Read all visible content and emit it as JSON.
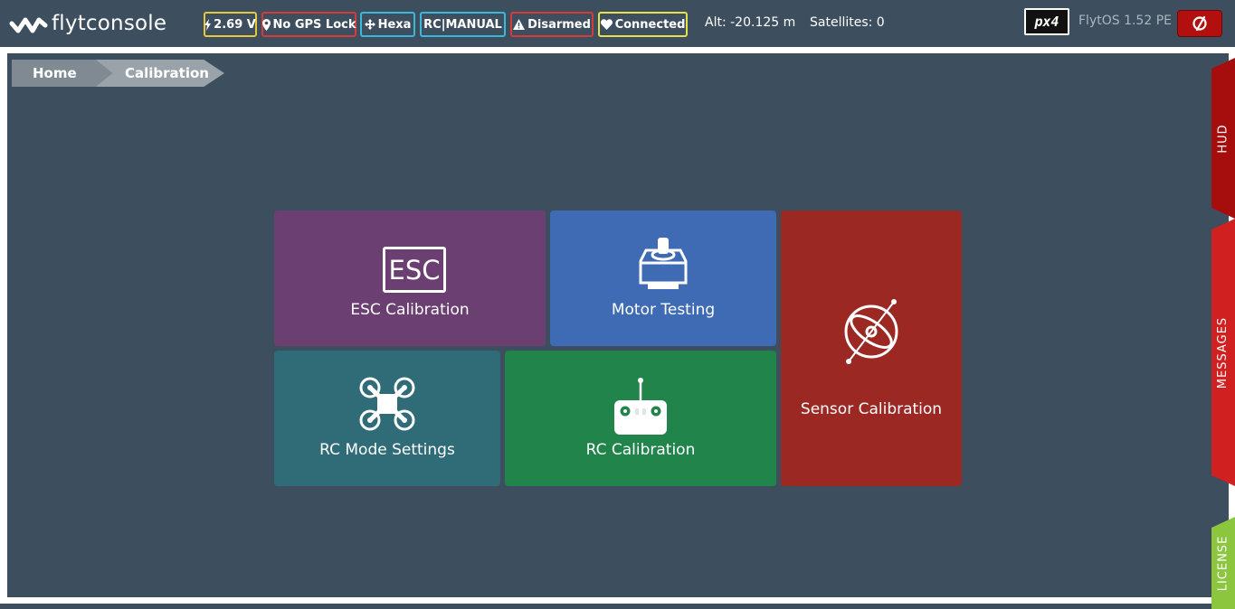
{
  "header": {
    "logo_light": "flyt",
    "logo_bold": "console",
    "badges": [
      {
        "icon": "lightning-icon",
        "label": "2.69 V",
        "color": "#e8c83a"
      },
      {
        "icon": "map-marker-icon",
        "label": "No GPS Lock",
        "color": "#d83a3a"
      },
      {
        "icon": "move-arrows-icon",
        "label": "Hexa",
        "color": "#3ab8d8"
      },
      {
        "icon": "",
        "label": "RC|MANUAL",
        "color": "#3ab8d8"
      },
      {
        "icon": "warning-triangle-icon",
        "label": "Disarmed",
        "color": "#d83a3a"
      },
      {
        "icon": "heart-icon",
        "label": "Connected",
        "color": "#e8e04a"
      }
    ],
    "altitude": "Alt: -20.125 m",
    "satellites": "Satellites: 0",
    "px4_logo_text": "px4",
    "version": "FlytOS 1.52 PE",
    "power_icon": "power-off-icon",
    "power_button_color": "#b20f0f"
  },
  "breadcrumb": {
    "home": "Home",
    "current": "Calibration"
  },
  "tiles": {
    "esc": {
      "label": "ESC Calibration",
      "icon_text": "ESC",
      "color": "#6b3f72"
    },
    "motor": {
      "label": "Motor Testing",
      "icon": "motor-icon",
      "color": "#3e6bb4"
    },
    "sensor": {
      "label": "Sensor Calibration",
      "icon": "gyroscope-icon",
      "color": "#9b2823"
    },
    "rc_mode": {
      "label": "RC Mode Settings",
      "icon": "quadcopter-icon",
      "color": "#2f6c78"
    },
    "rc_cal": {
      "label": "RC Calibration",
      "icon": "rc-transmitter-icon",
      "color": "#21844a"
    }
  },
  "side_tabs": {
    "hud": "HUD",
    "messages": "MESSAGES",
    "license": "LICENSE"
  },
  "colors": {
    "background": "#3d4f5e",
    "hud_tab": "#a60e0e",
    "messages_tab": "#d02020",
    "license_tab": "#8cc63f"
  }
}
